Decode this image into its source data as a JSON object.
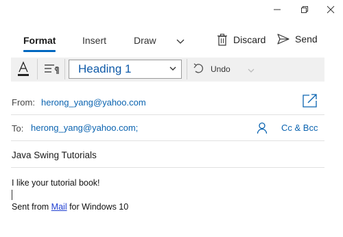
{
  "tabs": [
    {
      "label": "Format",
      "active": true
    },
    {
      "label": "Insert",
      "active": false
    },
    {
      "label": "Draw",
      "active": false
    }
  ],
  "actions": {
    "discard_label": "Discard",
    "send_label": "Send"
  },
  "toolbar": {
    "paragraph_style": "Heading 1",
    "undo_label": "Undo"
  },
  "message": {
    "from_label": "From:",
    "from_value": "herong_yang@yahoo.com",
    "to_label": "To:",
    "to_value": "herong_yang@yahoo.com;",
    "cc_bcc_label": "Cc & Bcc",
    "subject": "Java Swing Tutorials",
    "body_line1": "I like your tutorial book!",
    "signature_prefix": "Sent from ",
    "signature_link": "Mail",
    "signature_suffix": " for Windows 10"
  },
  "colors": {
    "accent": "#0067c0",
    "link": "#0a63b0"
  }
}
